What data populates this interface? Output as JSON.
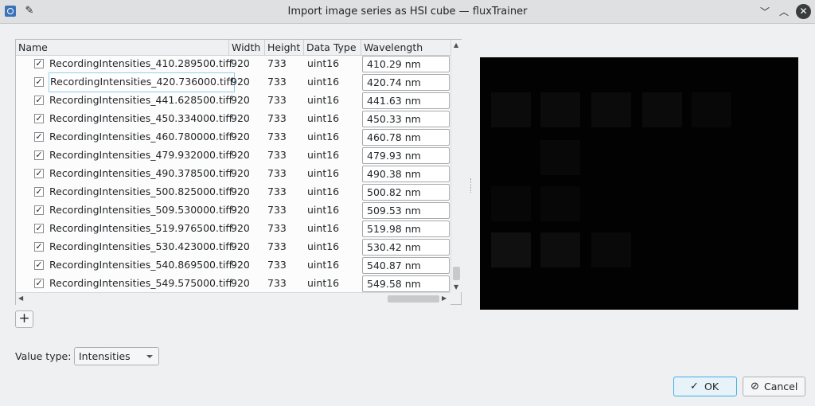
{
  "window": {
    "title": "Import image series as HSI cube — fluxTrainer",
    "app_icon": "app-icon",
    "pin_icon": "pin-icon",
    "minimize_icon": "chevron-down-icon",
    "maximize_icon": "chevron-up-icon",
    "close_icon": "close-icon"
  },
  "table": {
    "columns": [
      "Name",
      "Width",
      "Height",
      "Data Type",
      "Wavelength"
    ],
    "rows": [
      {
        "name": "RecordingIntensities_410.289500.tiff",
        "width": "920",
        "height": "733",
        "type": "uint16",
        "wavelength": "410.29 nm",
        "checked": true
      },
      {
        "name": "RecordingIntensities_420.736000.tiff",
        "width": "920",
        "height": "733",
        "type": "uint16",
        "wavelength": "420.74 nm",
        "checked": true
      },
      {
        "name": "RecordingIntensities_441.628500.tiff",
        "width": "920",
        "height": "733",
        "type": "uint16",
        "wavelength": "441.63 nm",
        "checked": true
      },
      {
        "name": "RecordingIntensities_450.334000.tiff",
        "width": "920",
        "height": "733",
        "type": "uint16",
        "wavelength": "450.33 nm",
        "checked": true
      },
      {
        "name": "RecordingIntensities_460.780000.tiff",
        "width": "920",
        "height": "733",
        "type": "uint16",
        "wavelength": "460.78 nm",
        "checked": true
      },
      {
        "name": "RecordingIntensities_479.932000.tiff",
        "width": "920",
        "height": "733",
        "type": "uint16",
        "wavelength": "479.93 nm",
        "checked": true
      },
      {
        "name": "RecordingIntensities_490.378500.tiff",
        "width": "920",
        "height": "733",
        "type": "uint16",
        "wavelength": "490.38 nm",
        "checked": true
      },
      {
        "name": "RecordingIntensities_500.825000.tiff",
        "width": "920",
        "height": "733",
        "type": "uint16",
        "wavelength": "500.82 nm",
        "checked": true
      },
      {
        "name": "RecordingIntensities_509.530000.tiff",
        "width": "920",
        "height": "733",
        "type": "uint16",
        "wavelength": "509.53 nm",
        "checked": true
      },
      {
        "name": "RecordingIntensities_519.976500.tiff",
        "width": "920",
        "height": "733",
        "type": "uint16",
        "wavelength": "519.98 nm",
        "checked": true
      },
      {
        "name": "RecordingIntensities_530.423000.tiff",
        "width": "920",
        "height": "733",
        "type": "uint16",
        "wavelength": "530.42 nm",
        "checked": true
      },
      {
        "name": "RecordingIntensities_540.869500.tiff",
        "width": "920",
        "height": "733",
        "type": "uint16",
        "wavelength": "540.87 nm",
        "checked": true
      },
      {
        "name": "RecordingIntensities_549.575000.tiff",
        "width": "920",
        "height": "733",
        "type": "uint16",
        "wavelength": "549.58 nm",
        "checked": true
      }
    ],
    "selected_row": 1,
    "check_mark": "✓"
  },
  "add_button": {
    "label": "+"
  },
  "value_type": {
    "label": "Value type:",
    "selected": "Intensities"
  },
  "buttons": {
    "ok": {
      "label": "OK",
      "icon": "check-icon"
    },
    "cancel": {
      "label": "Cancel",
      "icon": "cancel-icon"
    }
  },
  "colors": {
    "accent": "#3daee9",
    "preview_bg": "#020202"
  }
}
